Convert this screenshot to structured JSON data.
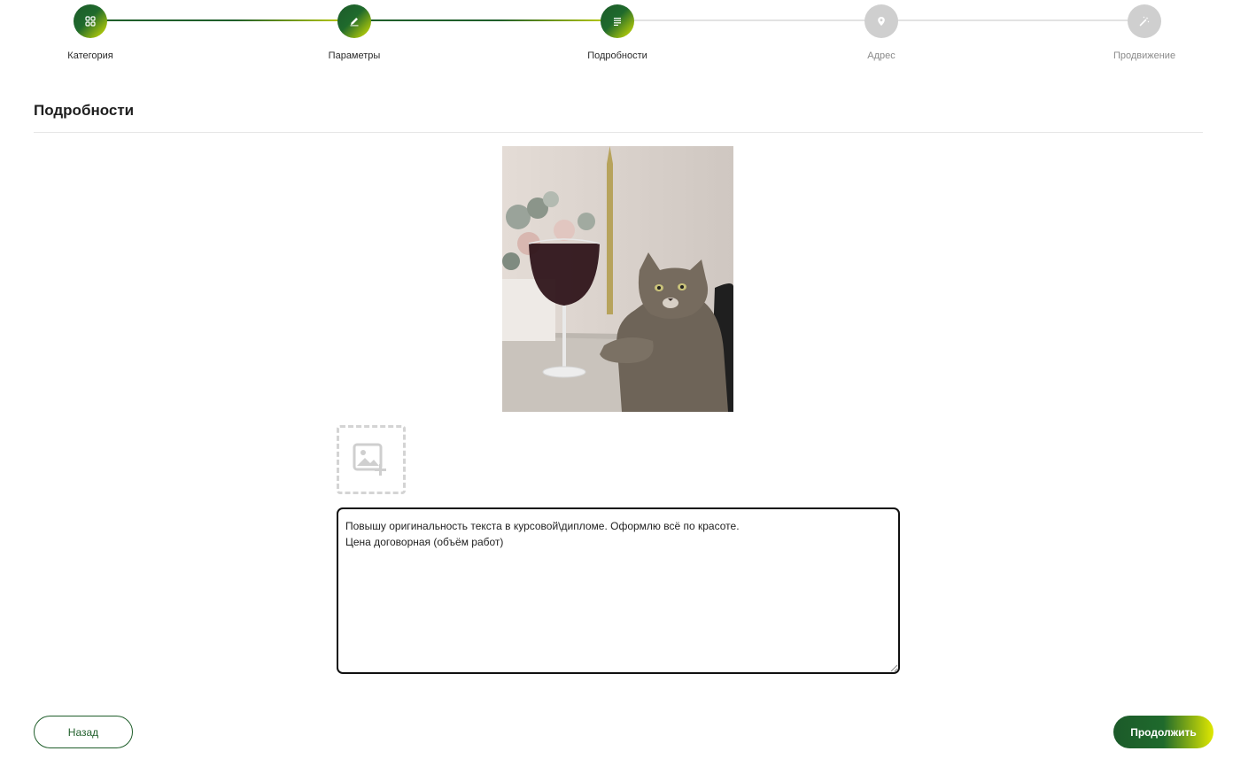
{
  "stepper": {
    "steps": [
      {
        "label": "Категория",
        "icon": "grid-icon",
        "state": "active"
      },
      {
        "label": "Параметры",
        "icon": "pencil-icon",
        "state": "active"
      },
      {
        "label": "Подробности",
        "icon": "list-icon",
        "state": "active"
      },
      {
        "label": "Адрес",
        "icon": "location-pin-icon",
        "state": "inactive"
      },
      {
        "label": "Продвижение",
        "icon": "magic-wand-icon",
        "state": "inactive"
      }
    ]
  },
  "section": {
    "title": "Подробности"
  },
  "photo": {
    "subject": "photo-thumbnail"
  },
  "add_photo": {
    "icon": "add-image-icon"
  },
  "description": {
    "value": "Повышу оригинальность текста в курсовой\\дипломе. Оформлю всё по красоте.\nЦена договорная (объём работ)"
  },
  "buttons": {
    "back_label": "Назад",
    "next_label": "Продолжить"
  },
  "colors": {
    "accent_dark": "#1f5e2a",
    "accent_light": "#d9e300",
    "inactive": "#cfcfcf"
  }
}
